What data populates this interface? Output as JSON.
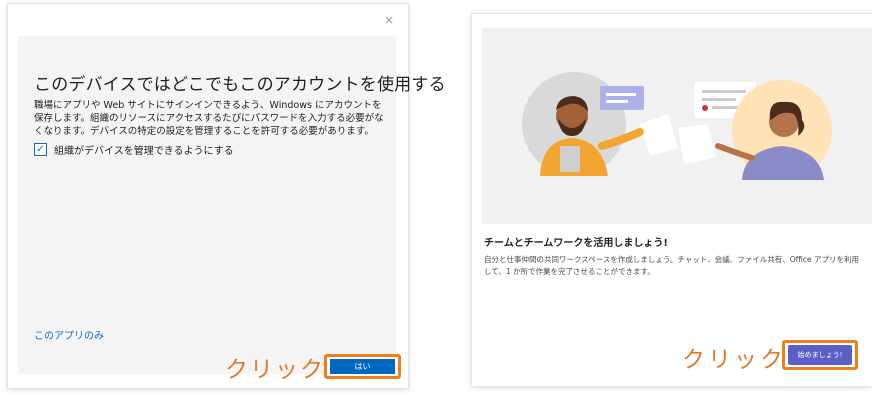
{
  "left_dialog": {
    "close_glyph": "×",
    "title": "このデバイスではどこでもこのアカウントを使用する",
    "description": "職場にアプリや Web サイトにサインインできるよう、Windows にアカウントを保存します。組織のリソースにアクセスするたびにパスワードを入力する必要がなくなります。デバイスの特定の設定を管理することを許可する必要があります。",
    "checkbox_checked": true,
    "checkbox_glyph": "✓",
    "checkbox_label": "組織がデバイスを管理できるようにする",
    "this_app_only_link": "このアプリのみ",
    "click_annotation": "クリック",
    "yes_button": "はい"
  },
  "right_card": {
    "heading": "チームとチームワークを活用しましょう!",
    "description": "自分と仕事仲間の共同ワークスペースを作成しましょう。チャット、会議、ファイル共有、Office アプリを利用して、1 か所で作業を完了させることができます。",
    "click_annotation": "クリック",
    "start_button": "始めましょう!"
  },
  "colors": {
    "accent_blue": "#0067c0",
    "teams_purple": "#5b5fc7",
    "highlight_orange": "#f07f1b",
    "annotation_orange": "#e07b2e"
  }
}
